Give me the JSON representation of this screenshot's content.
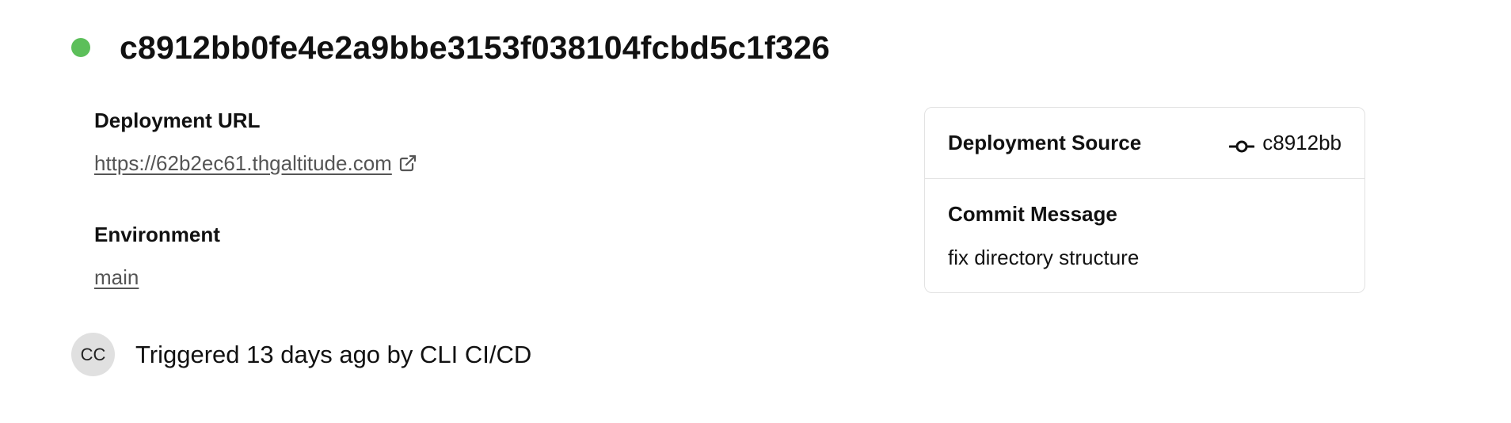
{
  "deployment": {
    "status_color": "#5cbf5a",
    "commit_hash": "c8912bb0fe4e2a9bbe3153f038104fcbd5c1f326"
  },
  "details": {
    "url_label": "Deployment URL",
    "url_value": "https://62b2ec61.thgaltitude.com",
    "url_icon": "external-link-icon",
    "environment_label": "Environment",
    "environment_value": "main"
  },
  "source_card": {
    "source_label": "Deployment Source",
    "source_icon": "git-commit-icon",
    "short_hash": "c8912bb",
    "commit_message_label": "Commit Message",
    "commit_message": "fix directory structure"
  },
  "trigger": {
    "avatar_initials": "CC",
    "text": "Triggered 13 days ago by CLI CI/CD"
  }
}
